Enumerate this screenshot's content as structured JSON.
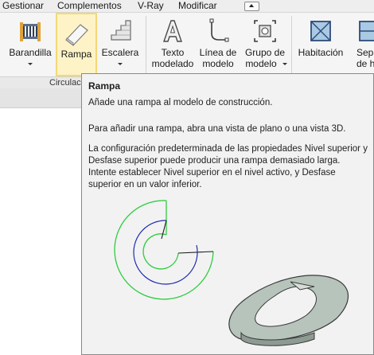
{
  "menu": {
    "items": [
      "Gestionar",
      "Complementos",
      "V-Ray",
      "Modificar"
    ],
    "extra_icon": "chevron-up-icon"
  },
  "ribbon": {
    "tools": [
      {
        "id": "barandilla",
        "lines": [
          "Barandilla"
        ],
        "dropdown": true,
        "icon": "railing-icon"
      },
      {
        "id": "rampa",
        "lines": [
          "Rampa"
        ],
        "dropdown": false,
        "icon": "ramp-icon",
        "active": true
      },
      {
        "id": "escalera",
        "lines": [
          "Escalera"
        ],
        "dropdown": true,
        "icon": "stair-icon"
      },
      {
        "id": "texto-modelado",
        "lines": [
          "Texto",
          "modelado"
        ],
        "dropdown": false,
        "icon": "model-text-icon"
      },
      {
        "id": "linea-modelo",
        "lines": [
          "Línea de",
          "modelo"
        ],
        "dropdown": false,
        "icon": "model-line-icon"
      },
      {
        "id": "grupo-modelo",
        "lines": [
          "Grupo de",
          "modelo"
        ],
        "dropdown": true,
        "icon": "model-group-icon"
      },
      {
        "id": "habitacion",
        "lines": [
          "Habitación"
        ],
        "dropdown": false,
        "icon": "room-icon"
      },
      {
        "id": "separador",
        "lines": [
          "Sepa",
          "de ha"
        ],
        "dropdown": false,
        "icon": "room-separator-icon"
      }
    ],
    "panel_label": "Circulació"
  },
  "tooltip": {
    "title": "Rampa",
    "description": "Añade una rampa al modelo de construcción.",
    "paragraph1": "Para añadir una rampa, abra una vista de plano o una vista 3D.",
    "paragraph2": "La configuración predeterminada de las propiedades Nivel superior y Desfase superior puede producir una rampa demasiado larga. Intente establecer Nivel superior en el nivel activo, y Desfase superior en un valor inferior."
  },
  "colors": {
    "active_fill": "#fdf3c6",
    "active_border": "#f3d876",
    "ramp_plan_outer": "#2ecc40",
    "ramp_plan_inner": "#1f2bb0",
    "ramp_3d": "#b7c4bc"
  }
}
